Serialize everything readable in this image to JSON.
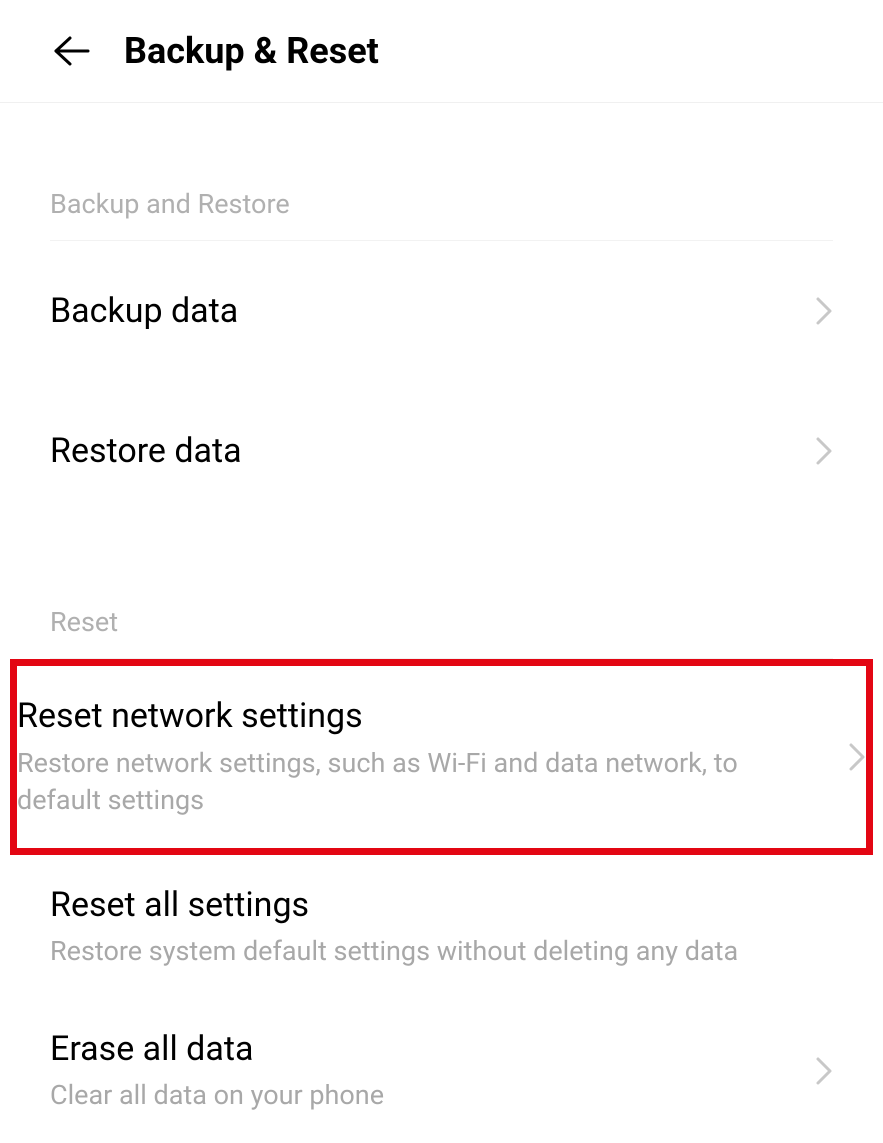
{
  "header": {
    "title": "Backup & Reset"
  },
  "sections": {
    "backup": {
      "header": "Backup and Restore",
      "items": [
        {
          "title": "Backup data"
        },
        {
          "title": "Restore data"
        }
      ]
    },
    "reset": {
      "header": "Reset",
      "items": [
        {
          "title": "Reset network settings",
          "subtitle": "Restore network settings, such as Wi-Fi and data network, to default settings"
        },
        {
          "title": "Reset all settings",
          "subtitle": "Restore system default settings without deleting any data"
        },
        {
          "title": "Erase all data",
          "subtitle": "Clear all data on your phone"
        }
      ]
    }
  }
}
